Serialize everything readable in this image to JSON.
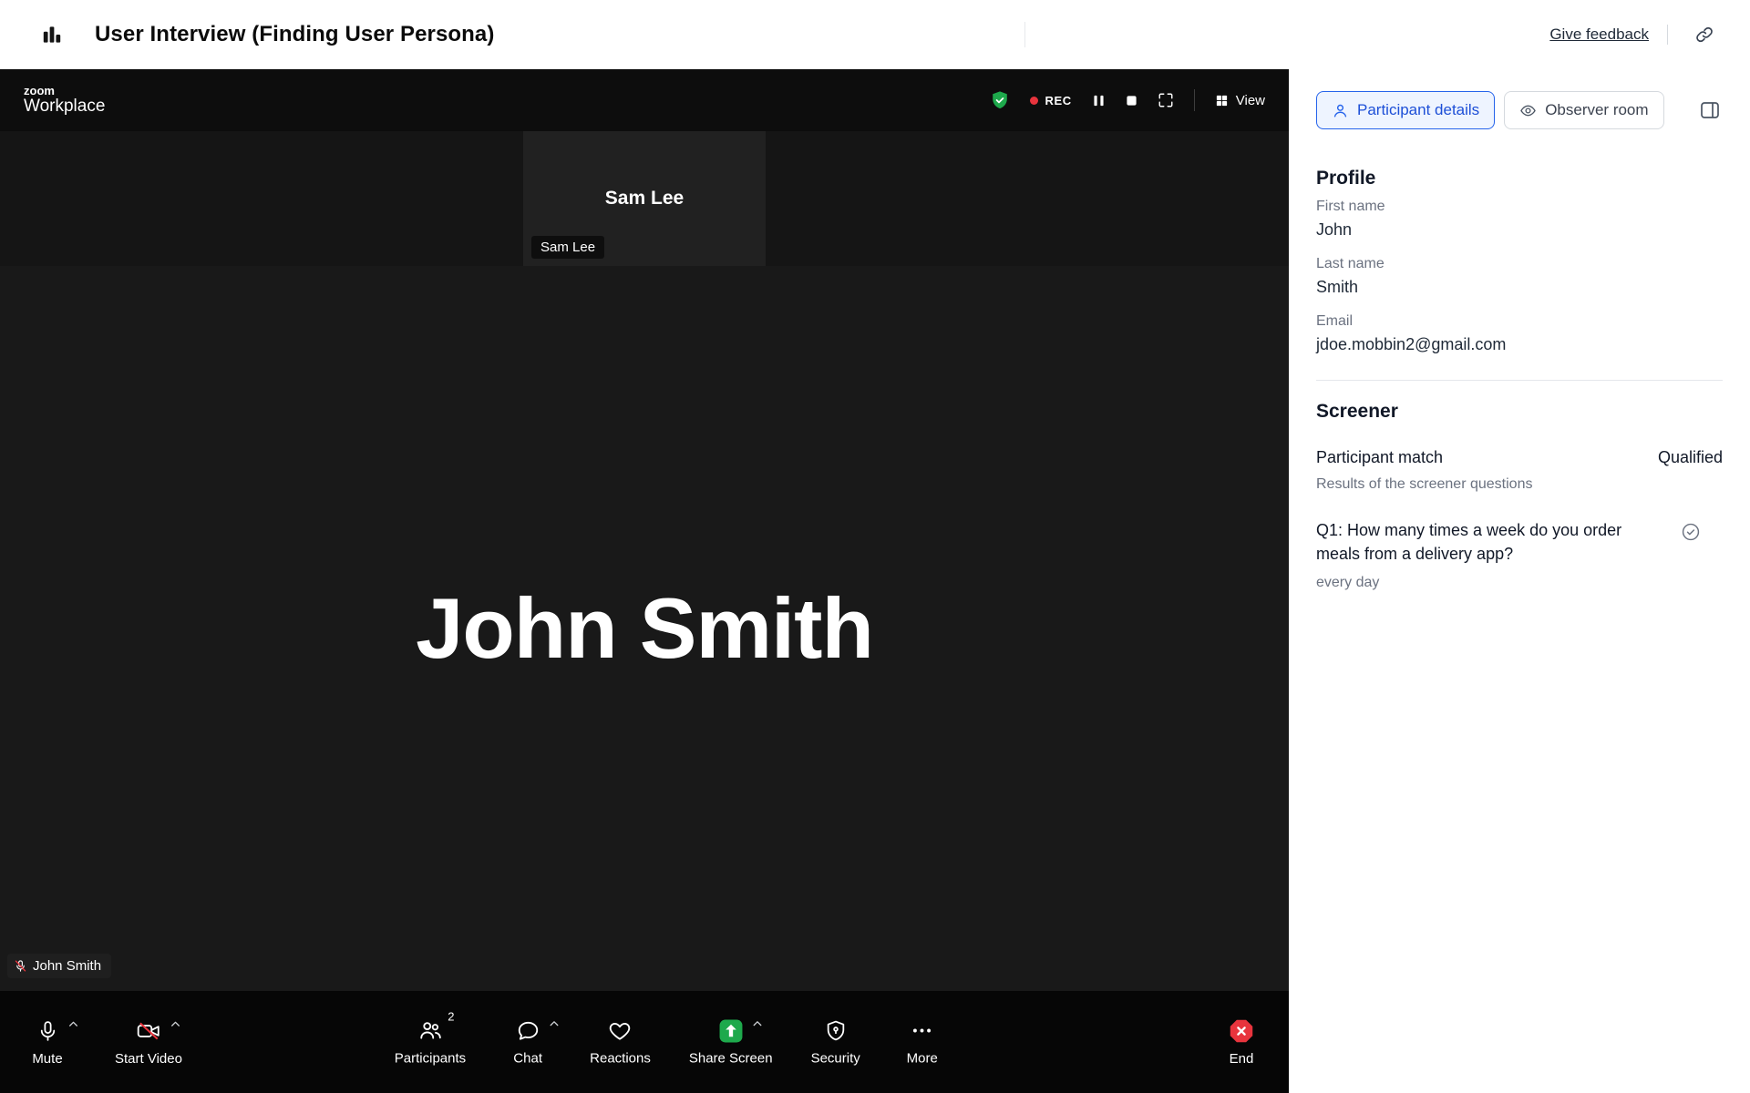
{
  "colors": {
    "accent_blue": "#2563eb",
    "rec_red": "#e8343d",
    "share_green": "#1ea94c",
    "end_red": "#e8343d",
    "encryption_green": "#1ea94c",
    "panel_text": "#111827",
    "muted_text": "#6b7280"
  },
  "header": {
    "title": "User Interview (Finding User Persona)",
    "feedback_link": "Give feedback"
  },
  "zoom": {
    "brand_line1": "zoom",
    "brand_line2": "Workplace",
    "rec_label": "REC",
    "view_label": "View",
    "thumbnail": {
      "name": "Sam Lee",
      "tag": "Sam Lee"
    },
    "stage": {
      "name": "John Smith",
      "tag": "John Smith"
    },
    "toolbar": {
      "mute_label": "Mute",
      "start_video_label": "Start Video",
      "participants_label": "Participants",
      "participants_count": "2",
      "chat_label": "Chat",
      "reactions_label": "Reactions",
      "share_screen_label": "Share Screen",
      "security_label": "Security",
      "more_label": "More",
      "end_label": "End"
    }
  },
  "sidebar": {
    "tabs": [
      {
        "label": "Participant details"
      },
      {
        "label": "Observer room"
      }
    ],
    "profile": {
      "heading": "Profile",
      "fields": [
        {
          "label": "First name",
          "value": "John"
        },
        {
          "label": "Last name",
          "value": "Smith"
        },
        {
          "label": "Email",
          "value": "jdoe.mobbin2@gmail.com"
        }
      ]
    },
    "screener": {
      "heading": "Screener",
      "match_label": "Participant match",
      "match_value": "Qualified",
      "subtitle": "Results of the screener questions",
      "questions": [
        {
          "question": "Q1: How many times a week do you order meals from a delivery app?",
          "answer": "every day"
        }
      ]
    }
  },
  "icons": {
    "app-logo-icon": "bar-chart glyph",
    "link-icon": "chain link",
    "encryption-shield-icon": "green shield with check",
    "rec-dot": "red recording dot",
    "pause-icon": "pause bars",
    "stop-icon": "stop square",
    "fullscreen-icon": "expand corners",
    "grid-view-icon": "2x2 grid",
    "mic-icon": "microphone",
    "mic-off-icon": "microphone with red slash",
    "camera-off-icon": "camera with red slash",
    "participants-icon": "two people",
    "chat-icon": "speech bubble",
    "heart-icon": "heart outline",
    "share-screen-icon": "green square with up arrow",
    "shield-icon": "security shield",
    "ellipsis-icon": "three dots",
    "end-call-icon": "red octagon with x",
    "person-icon": "single person",
    "observer-icon": "eye",
    "collapse-panel-icon": "panel with divider line",
    "check-circle-icon": "circle with check",
    "chevron-up-icon": "chevron up"
  }
}
